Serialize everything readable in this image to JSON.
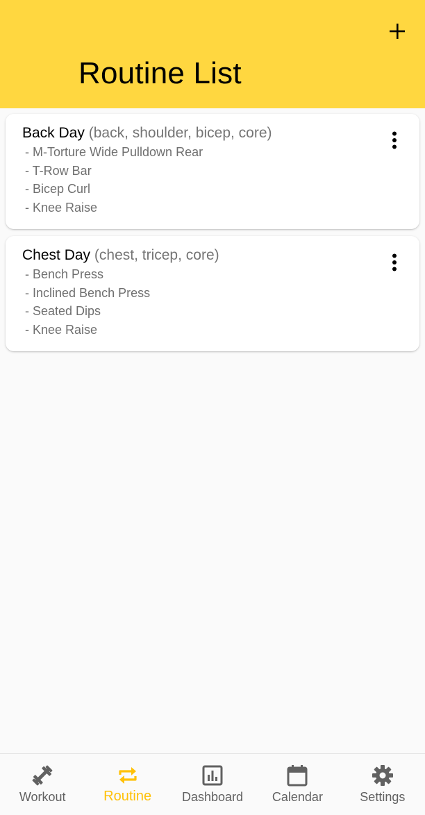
{
  "header": {
    "title": "Routine List",
    "add_icon": "plus-icon",
    "background": "#ffd740"
  },
  "routines": [
    {
      "name": "Back Day",
      "tags": "(back, shoulder, bicep, core)",
      "exercises": [
        "- M-Torture Wide Pulldown Rear",
        "- T-Row Bar",
        "- Bicep Curl",
        "- Knee Raise"
      ],
      "menu_icon": "more-vert-icon"
    },
    {
      "name": "Chest Day",
      "tags": "(chest, tricep, core)",
      "exercises": [
        "- Bench Press",
        "- Inclined Bench Press",
        "- Seated Dips",
        "- Knee Raise"
      ],
      "menu_icon": "more-vert-icon"
    }
  ],
  "bottom_nav": {
    "active_color": "#ffc107",
    "items": [
      {
        "label": "Workout",
        "icon": "dumbbell-icon",
        "active": false
      },
      {
        "label": "Routine",
        "icon": "repeat-icon",
        "active": true
      },
      {
        "label": "Dashboard",
        "icon": "bar-chart-icon",
        "active": false
      },
      {
        "label": "Calendar",
        "icon": "calendar-icon",
        "active": false
      },
      {
        "label": "Settings",
        "icon": "gear-icon",
        "active": false
      }
    ]
  }
}
